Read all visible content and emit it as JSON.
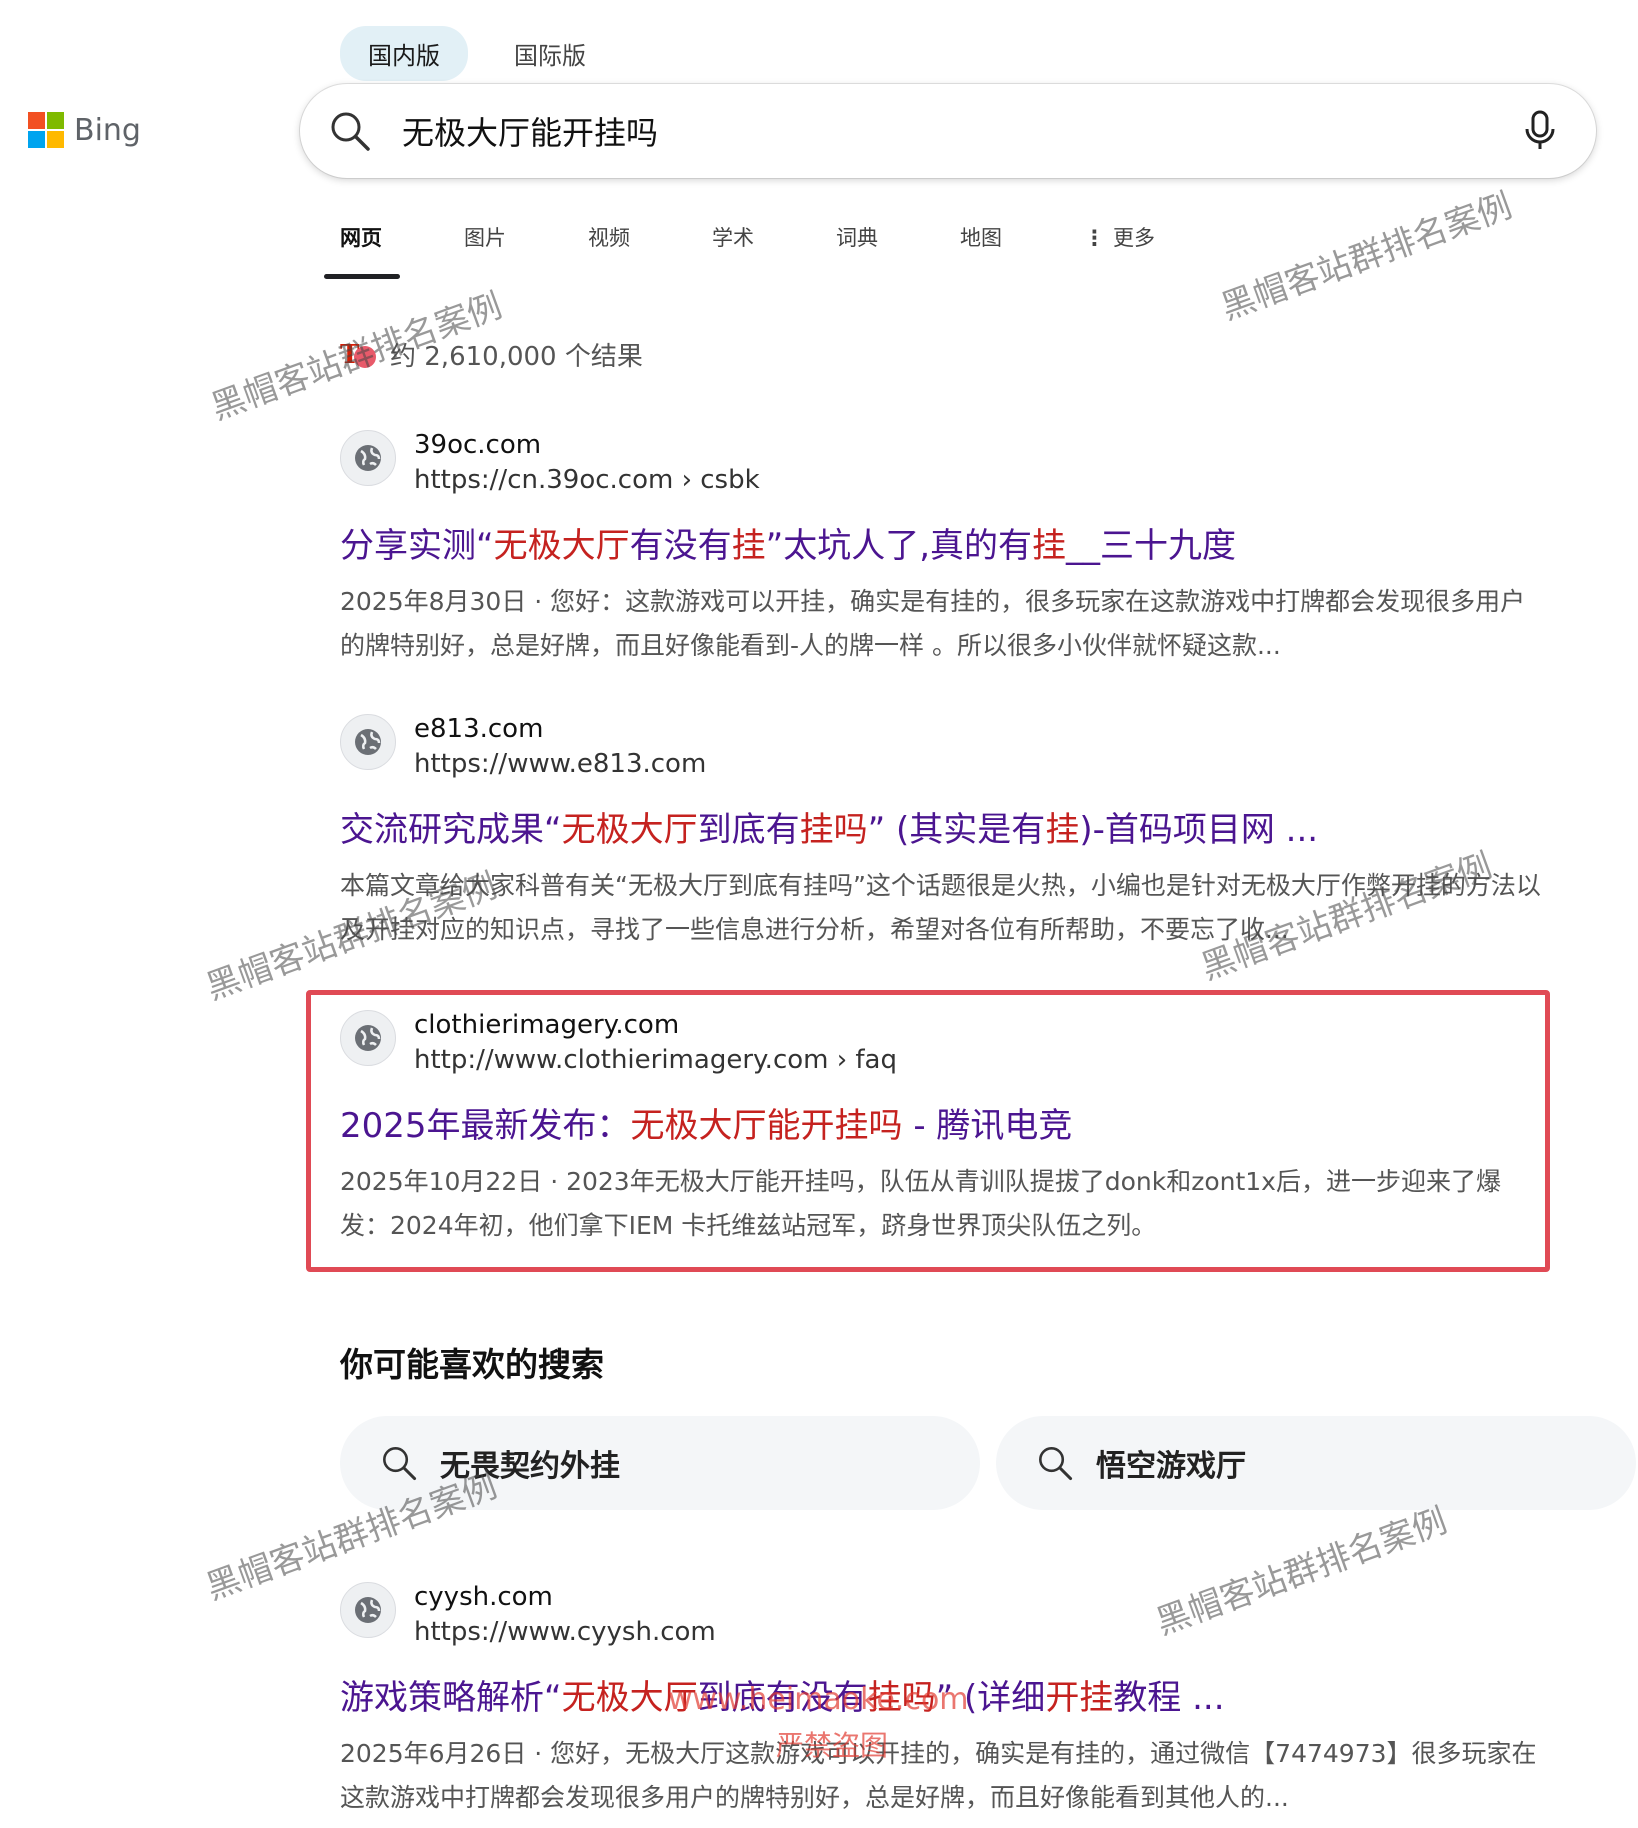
{
  "logo": {
    "text": "Bing",
    "colors": [
      "#f25022",
      "#7fba00",
      "#00a4ef",
      "#ffb900"
    ]
  },
  "market_tabs": [
    {
      "label": "国内版",
      "active": true
    },
    {
      "label": "国际版",
      "active": false
    }
  ],
  "search": {
    "query": "无极大厅能开挂吗",
    "icon": "search-icon",
    "mic_icon": "microphone-icon"
  },
  "nav_tabs": [
    {
      "label": "网页",
      "active": true
    },
    {
      "label": "图片"
    },
    {
      "label": "视频"
    },
    {
      "label": "学术"
    },
    {
      "label": "词典"
    },
    {
      "label": "地图"
    },
    {
      "label": "更多",
      "icon": "more-vertical-icon"
    }
  ],
  "results_count": "约 2,610,000 个结果",
  "results": [
    {
      "site": "39oc.com",
      "url": "https://cn.39oc.com › csbk",
      "title_parts": [
        {
          "t": "分享实测“"
        },
        {
          "t": "无极大厅",
          "hl": true
        },
        {
          "t": "有没有"
        },
        {
          "t": "挂",
          "hl": true
        },
        {
          "t": "”太坑人了,真的有"
        },
        {
          "t": "挂",
          "hl": true
        },
        {
          "t": "__三十九度"
        }
      ],
      "snippet": "2025年8月30日 · 您好：这款游戏可以开挂，确实是有挂的，很多玩家在这款游戏中打牌都会发现很多用户的牌特别好，总是好牌，而且好像能看到-人的牌一样 。所以很多小伙伴就怀疑这款..."
    },
    {
      "site": "e813.com",
      "url": "https://www.e813.com",
      "title_parts": [
        {
          "t": "交流研究成果“"
        },
        {
          "t": "无极大厅",
          "hl": true
        },
        {
          "t": "到底有"
        },
        {
          "t": "挂吗",
          "hl": true
        },
        {
          "t": "” (其实是有"
        },
        {
          "t": "挂",
          "hl": true
        },
        {
          "t": ")-首码项目网 ..."
        }
      ],
      "snippet": "本篇文章给大家科普有关“无极大厅到底有挂吗”这个话题很是火热，小编也是针对无极大厅作弊开挂的方法以及开挂对应的知识点，寻找了一些信息进行分析，希望对各位有所帮助，不要忘了收..."
    },
    {
      "site": "clothierimagery.com",
      "url": "http://www.clothierimagery.com › faq",
      "title_parts": [
        {
          "t": "2025年最新发布："
        },
        {
          "t": "无极大厅能开挂吗",
          "hl": true
        },
        {
          "t": " - 腾讯电竞"
        }
      ],
      "snippet": "2025年10月22日 · 2023年无极大厅能开挂吗，队伍从青训队提拔了donk和zont1x后，进一步迎来了爆发：2024年初，他们拿下IEM 卡托维兹站冠军，跻身世界顶尖队伍之列。"
    },
    {
      "site": "cyysh.com",
      "url": "https://www.cyysh.com",
      "title_parts": [
        {
          "t": "游戏策略解析“"
        },
        {
          "t": "无极大厅",
          "hl": true
        },
        {
          "t": "到底有没有"
        },
        {
          "t": "挂吗",
          "hl": true
        },
        {
          "t": "” (详细"
        },
        {
          "t": "开挂",
          "hl": true
        },
        {
          "t": "教程 ..."
        }
      ],
      "snippet": "2025年6月26日 · 您好，无极大厅这款游戏可以开挂的，确实是有挂的，通过微信【7474973】很多玩家在这款游戏中打牌都会发现很多用户的牌特别好，总是好牌，而且好像能看到其他人的..."
    }
  ],
  "related": {
    "heading": "你可能喜欢的搜索",
    "items": [
      "无畏契约外挂",
      "悟空游戏厅"
    ]
  },
  "watermarks": {
    "text": "黑帽客站群排名案例",
    "url": "www.heimaoke.com",
    "note": "严禁盗图"
  },
  "colors": {
    "title": "#4b1590",
    "highlight": "#c5221f",
    "box": "#e04a55"
  }
}
